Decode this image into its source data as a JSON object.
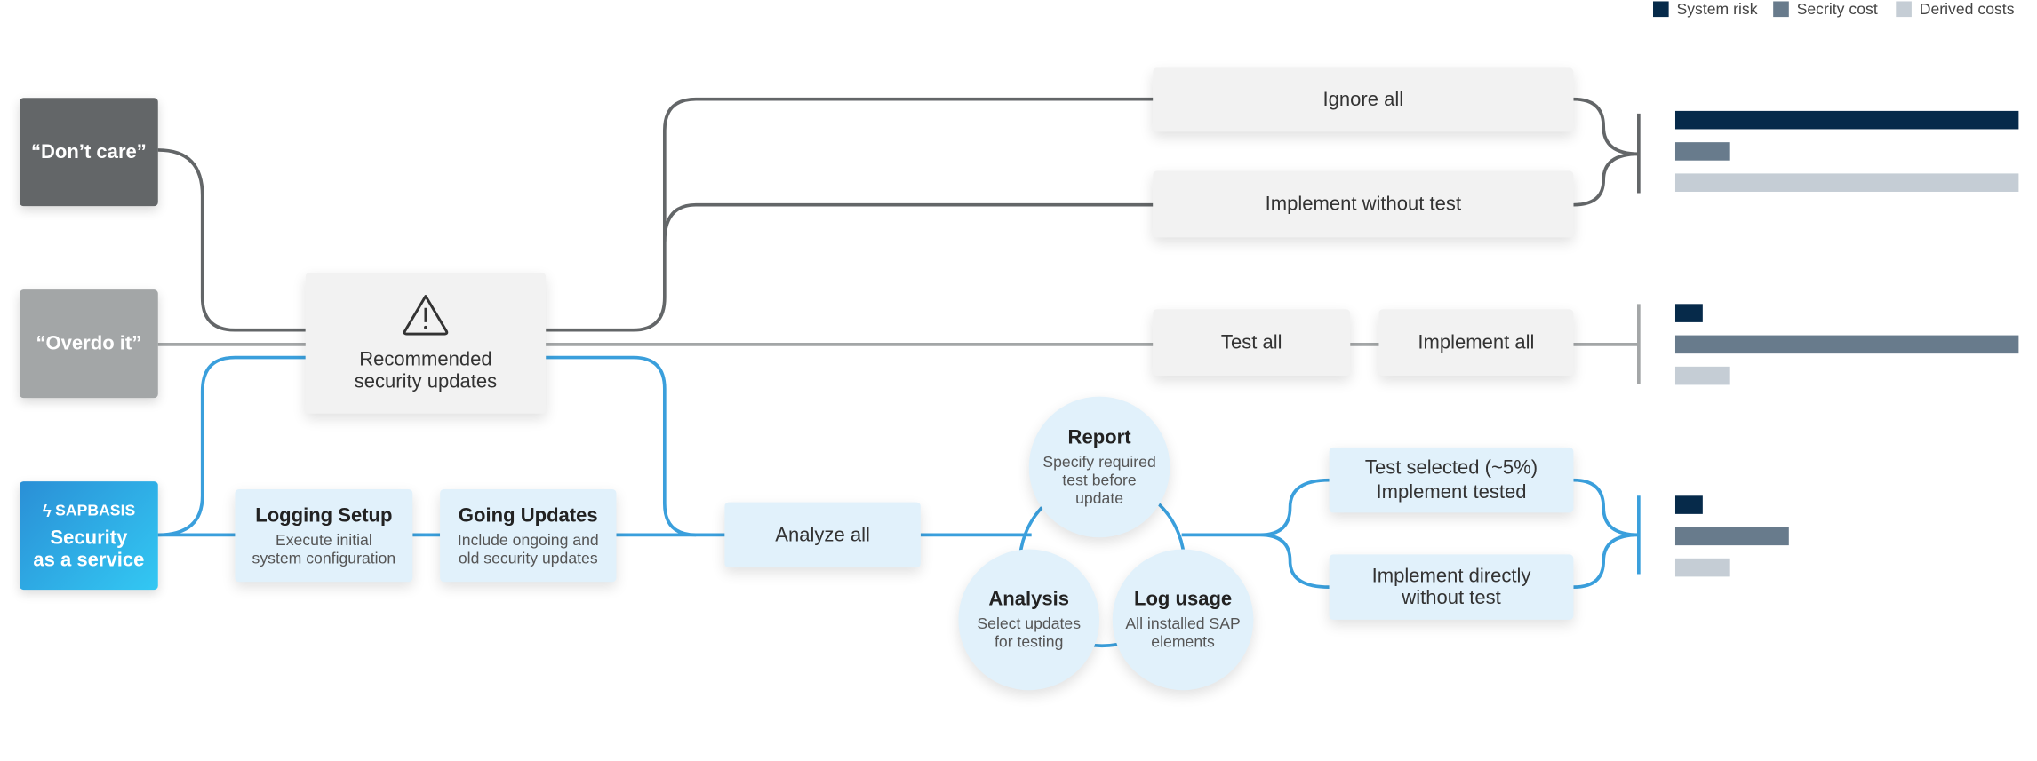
{
  "legend": [
    {
      "label": "System risk",
      "color": "#062a4a"
    },
    {
      "label": "Secrity cost",
      "color": "#687b8c"
    },
    {
      "label": "Derived costs",
      "color": "#c5cdd5"
    }
  ],
  "personas": {
    "dont_care": "“Don’t care”",
    "overdo_it": "“Overdo it”",
    "saas_brand": "SAPBASIS",
    "saas_line1": "Security",
    "saas_line2": "as a service"
  },
  "center": {
    "icon": "warning-icon",
    "line1": "Recommended",
    "line2": "security updates"
  },
  "dont_care_path": {
    "ignore": "Ignore all",
    "implement": "Implement without test"
  },
  "overdo_path": {
    "test": "Test all",
    "implement": "Implement all"
  },
  "saas_path": {
    "logging": {
      "title": "Logging Setup",
      "line1": "Execute initial",
      "line2": "system configuration"
    },
    "going": {
      "title": "Going Updates",
      "line1": "Include ongoing and",
      "line2": "old security updates"
    },
    "analyze": "Analyze all",
    "report": {
      "title": "Report",
      "line1": "Specify required",
      "line2": "test before",
      "line3": "update"
    },
    "analysis": {
      "title": "Analysis",
      "line1": "Select updates",
      "line2": "for testing"
    },
    "log_usage": {
      "title": "Log usage",
      "line1": "All installed SAP",
      "line2": "elements"
    },
    "selected": {
      "line1": "Test selected (~5%)",
      "line2": "Implement tested"
    },
    "direct": {
      "line1": "Implement directly",
      "line2": "without test"
    }
  },
  "colors": {
    "dark_line": "#636668",
    "light_line": "#a3a6a7",
    "blue_line": "#3a9fdc"
  },
  "chart_data": {
    "type": "bar",
    "orientation": "horizontal",
    "categories": [
      "Don't care",
      "Overdo it",
      "Security as a service"
    ],
    "series": [
      {
        "name": "System risk",
        "values": [
          100,
          8,
          8
        ]
      },
      {
        "name": "Secrity cost",
        "values": [
          16,
          100,
          33
        ]
      },
      {
        "name": "Derived costs",
        "values": [
          100,
          16,
          16
        ]
      }
    ],
    "xlim": [
      0,
      100
    ],
    "legend": "top-right"
  }
}
